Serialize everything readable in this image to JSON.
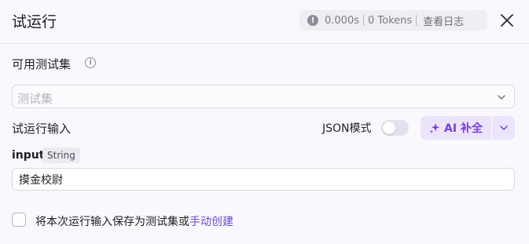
{
  "header": {
    "title": "试运行",
    "stats": {
      "duration": "0.000s",
      "tokens": "0 Tokens",
      "log_label": "查看日志"
    }
  },
  "test_set": {
    "label": "可用测试集",
    "select_placeholder": "测试集"
  },
  "run_input": {
    "label": "试运行输入",
    "json_mode_label": "JSON模式",
    "json_mode_on": false,
    "ai_button_label": "AI 补全"
  },
  "param": {
    "name": "input",
    "type": "String",
    "value": "摸金校尉"
  },
  "footer": {
    "save_text": "将本次运行输入保存为测试集或",
    "manual_create_link": "手动创建"
  },
  "colors": {
    "accent": "#7a3ee6",
    "link": "#6a49e6"
  }
}
